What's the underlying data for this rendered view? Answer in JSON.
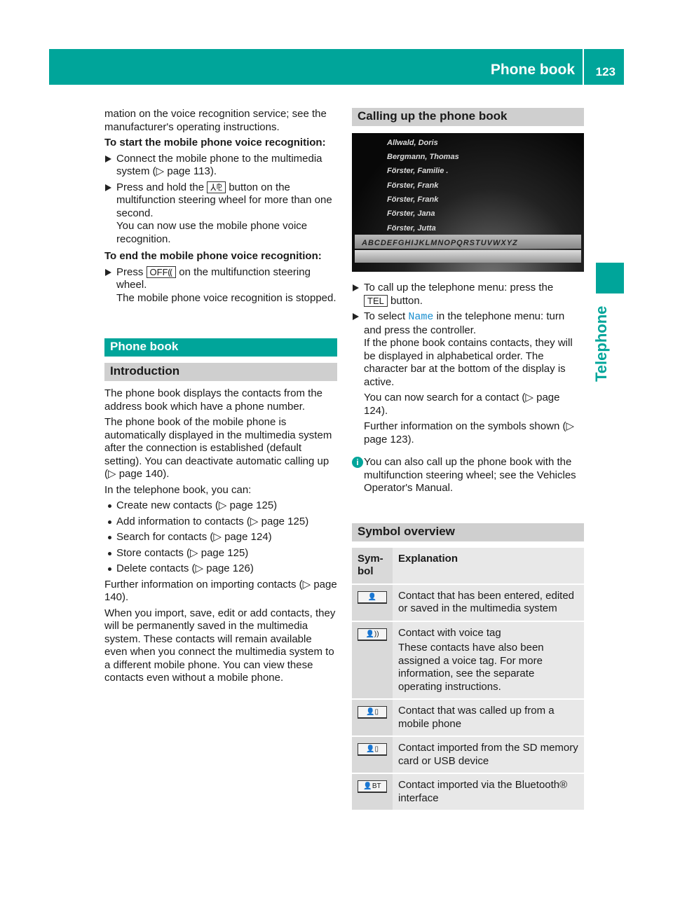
{
  "header": {
    "title": "Phone book",
    "page": "123"
  },
  "side_tab": "Telephone",
  "left": {
    "p1": "mation on the voice recognition service; see the manufacturer's operating instructions.",
    "start_heading": "To start the mobile phone voice recognition:",
    "start_step1": "Connect the mobile phone to the multimedia system (▷ page 113).",
    "start_step2a": "Press and hold the",
    "start_step2_icon": "voice-control-icon",
    "start_step2b": "button on the multifunction steering wheel for more than one second.",
    "start_step2c": "You can now use the mobile phone voice recognition.",
    "end_heading": "To end the mobile phone voice recognition:",
    "end_step1a": "Press",
    "end_step1_icon": "voice-off-icon",
    "end_step1b": "on the multifunction steering wheel.",
    "end_step1c": "The mobile phone voice recognition is stopped.",
    "section": "Phone book",
    "subsection": "Introduction",
    "intro1": "The phone book displays the contacts from the address book which have a phone number.",
    "intro2": "The phone book of the mobile phone is automatically displayed in the multimedia system after the connection is established (default setting). You can deactivate automatic calling up (▷ page 140).",
    "intro3": "In the telephone book, you can:",
    "bullets": [
      "Create new contacts (▷ page 125)",
      "Add information to contacts (▷ page 125)",
      "Search for contacts (▷ page 124)",
      "Store contacts (▷ page 125)",
      "Delete contacts (▷ page 126)"
    ],
    "intro4": "Further information on importing contacts (▷ page 140).",
    "intro5": "When you import, save, edit or add contacts, they will be permanently saved in the multimedia system. These contacts will remain available even when you connect the multimedia system to a different mobile phone. You can view these contacts even without a mobile phone."
  },
  "right": {
    "calling_heading": "Calling up the phone book",
    "screen": {
      "contacts": [
        "Allwald, Doris",
        "Bergmann, Thomas",
        "Förster, Familie .",
        "Förster, Frank",
        "Förster, Frank",
        "Förster, Jana",
        "Förster, Jutta"
      ],
      "alphabet": "ABCDEFGHIJKLMNOPQRSTUVWXYZ"
    },
    "step1a": "To call up the telephone menu: press the",
    "tel_key": "TEL",
    "step1b": "button.",
    "step2a": "To select",
    "step2_name": "Name",
    "step2b": "in the telephone menu: turn and press the controller.",
    "step2c": "If the phone book contains contacts, they will be displayed in alphabetical order. The character bar at the bottom of the display is active.",
    "step2d": "You can now search for a contact (▷ page 124).",
    "step2e": "Further information on the symbols shown (▷ page 123).",
    "info": "You can also call up the phone book with the multifunction steering wheel; see the Vehicles Operator's Manual.",
    "symbol_heading": "Symbol overview",
    "table": {
      "col1": "Sym-bol",
      "col2": "Explanation",
      "rows": [
        {
          "icon": "contact-icon",
          "glyph": "👤",
          "text": "Contact that has been entered, edited or saved in the multimedia system"
        },
        {
          "icon": "contact-voice-tag-icon",
          "glyph": "👤))",
          "text": "Contact with voice tag",
          "text2": "These contacts have also been assigned a voice tag. For more information, see the separate operating instructions."
        },
        {
          "icon": "contact-mobile-phone-icon",
          "glyph": "👤▯",
          "text": "Contact that was called up from a mobile phone"
        },
        {
          "icon": "contact-sd-usb-icon",
          "glyph": "👤▯",
          "text": "Contact imported from the SD memory card or USB device"
        },
        {
          "icon": "contact-bluetooth-icon",
          "glyph": "👤BT",
          "text": "Contact imported via the Bluetooth® interface"
        }
      ]
    }
  }
}
